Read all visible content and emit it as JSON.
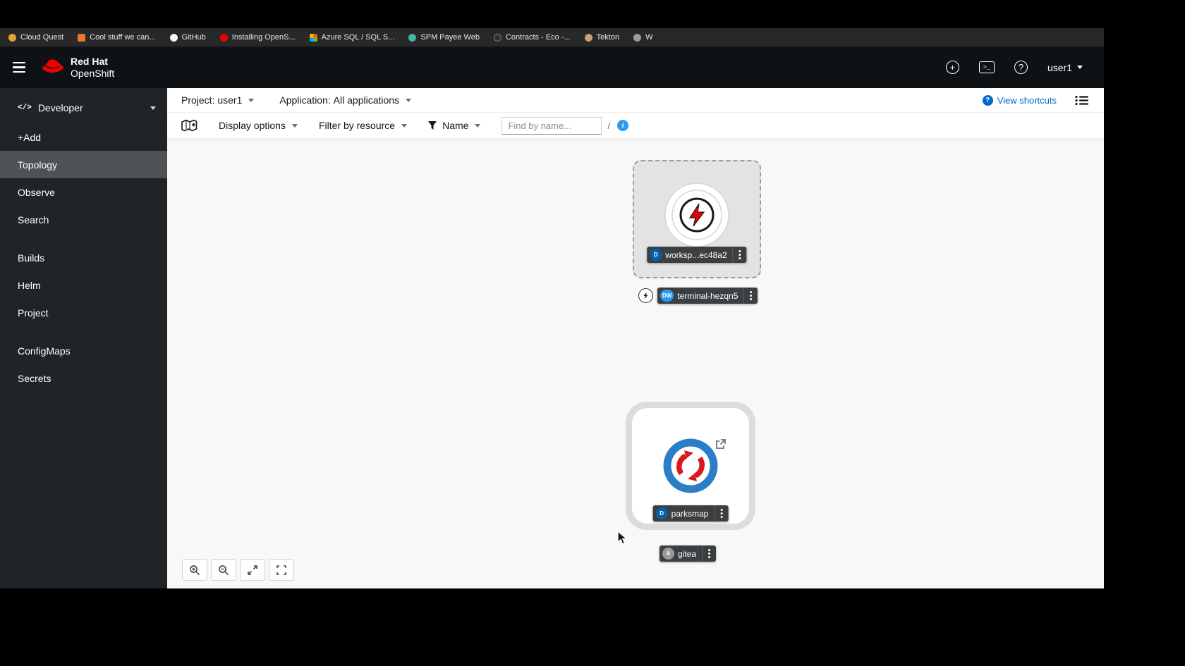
{
  "colors": {
    "accent_blue": "#0066cc",
    "link_blue": "#2b9af3",
    "redhat_red": "#ee0000",
    "masthead_bg": "#0f1214",
    "sidebar_bg": "#212427",
    "selected_nav_bg": "#4f5255",
    "badge_deployment": "#0b5ea8",
    "badge_devworkspace": "#2b9af3",
    "badge_application": "#97999b",
    "node_label_bg": "#3c3f42"
  },
  "bookmarks": {
    "items": [
      {
        "label": "Cloud Quest"
      },
      {
        "label": "Cool stuff we can..."
      },
      {
        "label": "GitHub"
      },
      {
        "label": "Installing OpenS..."
      },
      {
        "label": "Azure SQL / SQL S..."
      },
      {
        "label": "SPM Payee Web"
      },
      {
        "label": "Contracts - Eco -..."
      },
      {
        "label": "Tekton"
      },
      {
        "label": "W"
      }
    ]
  },
  "masthead": {
    "brand_line1": "Red Hat",
    "brand_line2": "OpenShift",
    "username": "user1"
  },
  "sidebar": {
    "perspective": "Developer",
    "perspective_icon": "</>",
    "items": [
      {
        "label": "+Add"
      },
      {
        "label": "Topology"
      },
      {
        "label": "Observe"
      },
      {
        "label": "Search"
      },
      {
        "label": "Builds"
      },
      {
        "label": "Helm"
      },
      {
        "label": "Project"
      },
      {
        "label": "ConfigMaps"
      },
      {
        "label": "Secrets"
      }
    ]
  },
  "context_bar": {
    "project_prefix": "Project:",
    "project_value": "user1",
    "application_prefix": "Application:",
    "application_value": "All applications",
    "view_shortcuts_label": "View shortcuts"
  },
  "toolbar": {
    "display_options_label": "Display options",
    "filter_by_resource_label": "Filter by resource",
    "name_filter_label": "Name",
    "find_placeholder": "Find by name...",
    "shortcut_hint": "/"
  },
  "topology": {
    "workspace": {
      "badge": "D",
      "label": "worksp...ec48a2"
    },
    "terminal": {
      "badge": "DW",
      "label": "terminal-hezqn5"
    },
    "parksmap": {
      "badge": "D",
      "label": "parksmap"
    },
    "gitea": {
      "badge": "A",
      "label": "gitea"
    }
  }
}
